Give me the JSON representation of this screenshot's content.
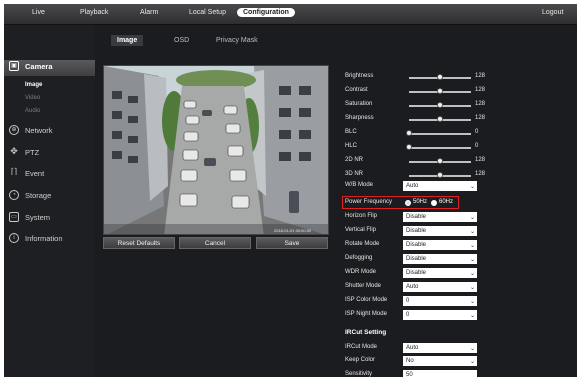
{
  "topnav": {
    "items": [
      "Live",
      "Playback",
      "Alarm",
      "Local Setup",
      "Configuration"
    ],
    "active": "Configuration",
    "logout": "Logout"
  },
  "sidebar": {
    "items": [
      {
        "label": "Camera",
        "icon": "camera-icon"
      },
      {
        "label": "Network",
        "icon": "network-icon"
      },
      {
        "label": "PTZ",
        "icon": "ptz-icon"
      },
      {
        "label": "Event",
        "icon": "event-icon"
      },
      {
        "label": "Storage",
        "icon": "storage-icon"
      },
      {
        "label": "System",
        "icon": "system-icon"
      },
      {
        "label": "Information",
        "icon": "info-icon"
      }
    ],
    "camera_sub": [
      "Image",
      "Video",
      "Audio"
    ]
  },
  "tabs": [
    "Image",
    "OSD",
    "Privacy Mask"
  ],
  "buttons": {
    "reset": "Reset Defaults",
    "cancel": "Cancel",
    "save": "Save"
  },
  "preview": {
    "timestamp": "2018-01-01 00:00:00"
  },
  "sliders": [
    {
      "label": "Brightness",
      "value": "128",
      "level": 0.5
    },
    {
      "label": "Contrast",
      "value": "128",
      "level": 0.5
    },
    {
      "label": "Saturation",
      "value": "128",
      "level": 0.5
    },
    {
      "label": "Sharpness",
      "value": "128",
      "level": 0.5
    },
    {
      "label": "BLC",
      "value": "0",
      "level": 0
    },
    {
      "label": "HLC",
      "value": "0",
      "level": 0
    },
    {
      "label": "2D NR",
      "value": "128",
      "level": 0.5
    },
    {
      "label": "3D NR",
      "value": "128",
      "level": 0.5
    }
  ],
  "wdr_mode_row": {
    "label": "W/B Mode",
    "value": "Auto"
  },
  "power_frequency": {
    "label": "Power Frequency",
    "options": [
      "50Hz",
      "60Hz"
    ],
    "selected": "50Hz"
  },
  "selects": [
    {
      "label": "Horizon Flip",
      "value": "Disable"
    },
    {
      "label": "Vertical Flip",
      "value": "Disable"
    },
    {
      "label": "Rotate Mode",
      "value": "Disable"
    },
    {
      "label": "Defogging",
      "value": "Disable"
    },
    {
      "label": "WDR Mode",
      "value": "Disable"
    },
    {
      "label": "Shutter Mode",
      "value": "Auto"
    },
    {
      "label": "ISP Color Mode",
      "value": "0"
    },
    {
      "label": "ISP Night Mode",
      "value": "0"
    }
  ],
  "ircut": {
    "title": "IRCut Setting",
    "rows": [
      {
        "label": "IRCut Mode",
        "value": "Auto"
      },
      {
        "label": "Keep Color",
        "value": "No"
      }
    ],
    "sensitivity": {
      "label": "Sensitivity",
      "value": "50"
    }
  }
}
